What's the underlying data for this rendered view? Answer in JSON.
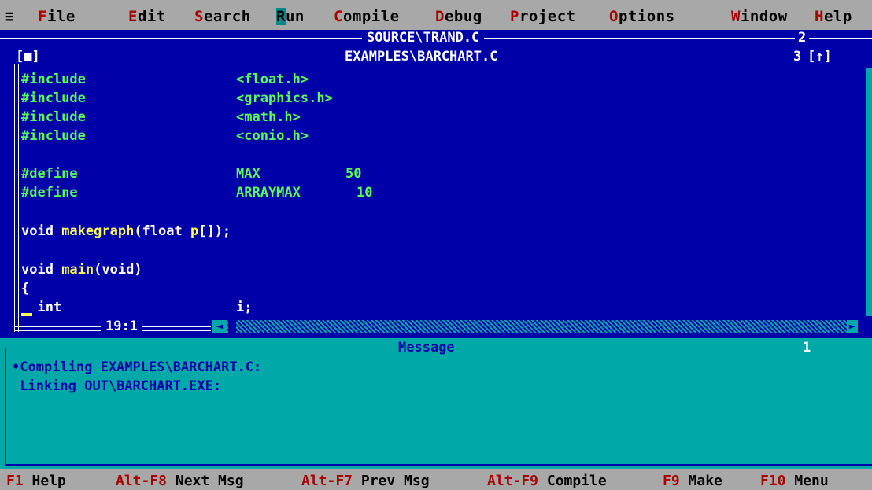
{
  "menubar": {
    "system_icon": "≡",
    "items": [
      {
        "hot": "F",
        "rest": "ile"
      },
      {
        "hot": "E",
        "rest": "dit"
      },
      {
        "hot": "S",
        "rest": "earch"
      },
      {
        "hot": "R",
        "rest": "un"
      },
      {
        "hot": "C",
        "rest": "ompile"
      },
      {
        "hot": "D",
        "rest": "ebug"
      },
      {
        "hot": "P",
        "rest": "roject"
      },
      {
        "hot": "O",
        "rest": "ptions"
      },
      {
        "hot": "W",
        "rest": "indow"
      },
      {
        "hot": "H",
        "rest": "elp"
      }
    ]
  },
  "background_window": {
    "title": "SOURCE\\TRAND.C",
    "number": "2"
  },
  "editor": {
    "close_icon": "[■]",
    "title": "EXAMPLES\\BARCHART.C",
    "number": "3",
    "zoom_icon": "[↑]",
    "cursor_position": "19:1",
    "lines": [
      {
        "a": "#include",
        "b": "<float.h>"
      },
      {
        "a": "#include",
        "b": "<graphics.h>"
      },
      {
        "a": "#include",
        "b": "<math.h>"
      },
      {
        "a": "#include",
        "b": "<conio.h>"
      },
      {
        "a": "#define",
        "b": "MAX",
        "c": "50"
      },
      {
        "a": "#define",
        "b": "ARRAYMAX",
        "c": "10"
      },
      {
        "kw1": "void ",
        "fn": "makegraph",
        "kw2": "(float ",
        "fn2": "p",
        "kw3": "[]);"
      },
      {
        "kw1": "void ",
        "fn": "main",
        "kw2": "(void)"
      },
      {
        "kw1": "{"
      },
      {
        "kw1": "  int",
        "kw2": "i;"
      }
    ]
  },
  "message_window": {
    "title": "Message",
    "number": "1",
    "lines": [
      "•Compiling EXAMPLES\\BARCHART.C:",
      " Linking OUT\\BARCHART.EXE:"
    ]
  },
  "status_bar": [
    {
      "key": "F1",
      "label": " Help"
    },
    {
      "key": "Alt-F8",
      "label": " Next Msg"
    },
    {
      "key": "Alt-F7",
      "label": " Prev Msg"
    },
    {
      "key": "Alt-F9",
      "label": " Compile"
    },
    {
      "key": "F9",
      "label": " Make"
    },
    {
      "key": "F10",
      "label": " Menu"
    }
  ],
  "colors": {
    "desktop_blue": "#0000a8",
    "menu_gray": "#a8a8a8",
    "message_cyan": "#00a8a8",
    "code_green": "#55ff55",
    "identifier_yellow": "#ffff55",
    "hotkey_red": "#a80000"
  }
}
